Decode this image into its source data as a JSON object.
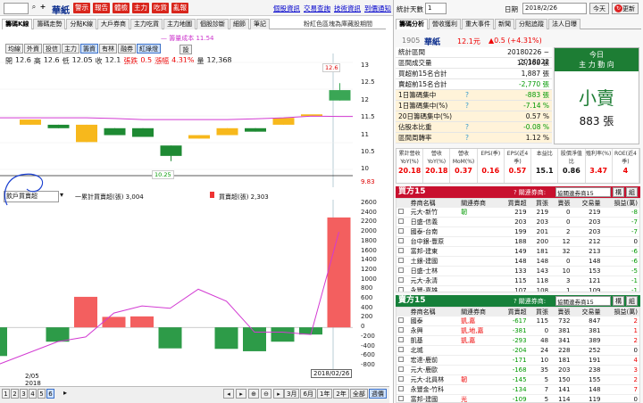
{
  "toolbar": {
    "stock_code": "",
    "stock_name": "華紙",
    "buttons": [
      "警示",
      "報告",
      "體檢",
      "主力",
      "吃貨",
      "亂報"
    ],
    "links": [
      "個股資訊",
      "交易查詢",
      "技術資訊",
      "到價通知"
    ]
  },
  "left": {
    "tabs": [
      "籌碼K線",
      "籌碼走勢",
      "分點K線",
      "大戶券商",
      "主力吃貨",
      "主力地圖",
      "個股診斷",
      "細節",
      "筆記"
    ],
    "note_right": "粉紅色區塊為庫藏股期間",
    "cost_legend": "— 籌量成本 11.54",
    "ma_buttons": [
      "均線",
      "外資",
      "投信",
      "主力",
      "籌資",
      "有林",
      "融券",
      "紅綠燈"
    ],
    "set_label": "設",
    "ohlc": {
      "open_label": "開",
      "open": "12.6",
      "high_label": "高",
      "high": "12.6",
      "low_label": "低",
      "low": "12.05",
      "close_label": "收",
      "close": "12.1",
      "change_label": "張跌",
      "change": "0.5",
      "pct_label": "漲幅",
      "pct": "4.31%",
      "vol_label": "量",
      "vol": "12,368"
    },
    "price_axis": [
      "13",
      "12.5",
      "12",
      "11.5",
      "11",
      "10.5",
      "10"
    ],
    "price_min_label": "9.83",
    "high_tag": "12.6",
    "low_tag": "10.25",
    "lower_select": "飲戶買賣超",
    "legend1": "一累計買賣超(張) 3,004",
    "legend2": "買賣超(張) 2,303",
    "vol_axis": [
      "2600",
      "2400",
      "2200",
      "2000",
      "1800",
      "1600",
      "1400",
      "1200",
      "1000",
      "800",
      "600",
      "400",
      "200",
      "0",
      "-200",
      "-400",
      "-600",
      "-800"
    ],
    "date_left": "2/05",
    "year_left": "2018",
    "date_tag": "2018/02/26",
    "pages": [
      "1",
      "2",
      "3",
      "4",
      "5",
      "6"
    ],
    "period_buttons": [
      "3月",
      "6月",
      "1年",
      "2年",
      "全部",
      "週價"
    ]
  },
  "right": {
    "stat_label": "統計天數",
    "stat_val": "1",
    "date_label": "日期",
    "date_val": "2018/2/26",
    "today_btn": "今天",
    "refresh_btn": "更新",
    "tabs": [
      "籌碼分析",
      "營收獲利",
      "重大事件",
      "新聞",
      "分點追蹤",
      "法人日曝"
    ],
    "stock_code": "1905",
    "stock_name": "華紙",
    "price": "12.1元",
    "change": "▲0.5 (+4.31%)",
    "summary": [
      {
        "label": "統計區間",
        "val": "20180226 ~ 2018022",
        "q": ""
      },
      {
        "label": "區間成交量",
        "val": "12,368 張",
        "q": ""
      },
      {
        "label": "買超前15名合計",
        "val": "1,887 張",
        "q": ""
      },
      {
        "label": "賣超前15名合計",
        "val": "-2,770 張",
        "q": ""
      },
      {
        "label": "1日籌碼集中",
        "val": "-883 張",
        "q": "?"
      },
      {
        "label": "1日籌碼集中(%)",
        "val": "-7.14 %",
        "q": "?"
      },
      {
        "label": "20日籌碼集中(%)",
        "val": "0.57 %",
        "q": ""
      },
      {
        "label": "佔股本比重",
        "val": "-0.08 %",
        "q": "?"
      },
      {
        "label": "區間周轉率",
        "val": "1.12 %",
        "q": "?"
      }
    ],
    "today_title": "今日",
    "today_sub": "主 力 動 向",
    "today_big": "小賣",
    "today_vol": "883 張",
    "stats": [
      {
        "h": "累計營收YoY(%)",
        "v": "20.18",
        "c": "red"
      },
      {
        "h": "營收YoY(%)",
        "v": "20.18",
        "c": "red"
      },
      {
        "h": "營收MoM(%)",
        "v": "0.37",
        "c": "red"
      },
      {
        "h": "EPS(季)",
        "v": "0.16",
        "c": "red"
      },
      {
        "h": "EPS(近4季)",
        "v": "0.57",
        "c": "red"
      },
      {
        "h": "本益比",
        "v": "15.1",
        "c": "black"
      },
      {
        "h": "股價淨值比",
        "v": "0.86",
        "c": "black"
      },
      {
        "h": "殖利率(%)",
        "v": "3.47",
        "c": "red"
      },
      {
        "h": "ROE(近4季)",
        "v": "4",
        "c": "red"
      }
    ],
    "buy_title": "買方15",
    "sell_title": "賣方15",
    "link_label": "關連券商:",
    "link_select": "協關連券商15",
    "link_btns": [
      "構",
      "組"
    ],
    "cols": [
      "券商名稱",
      "關連券商",
      "買賣超",
      "買張",
      "賣張",
      "交易量",
      "損益(萬)"
    ],
    "buy_rows": [
      [
        "元大-新竹",
        "韌",
        "219",
        "219",
        "0",
        "219",
        "-8"
      ],
      [
        "日盛-信義",
        "",
        "203",
        "203",
        "0",
        "203",
        "-7"
      ],
      [
        "國泰-台南",
        "",
        "199",
        "201",
        "2",
        "203",
        "-7"
      ],
      [
        "台中銀-豐原",
        "",
        "188",
        "200",
        "12",
        "212",
        "0"
      ],
      [
        "富邦-建東",
        "",
        "149",
        "181",
        "32",
        "213",
        "-6"
      ],
      [
        "土銀-建國",
        "",
        "148",
        "148",
        "0",
        "148",
        "-6"
      ],
      [
        "日盛-士林",
        "",
        "133",
        "143",
        "10",
        "153",
        "-5"
      ],
      [
        "元大-永清",
        "",
        "115",
        "118",
        "3",
        "121",
        "-1"
      ],
      [
        "永豐-嘉雄",
        "",
        "107",
        "108",
        "1",
        "109",
        "-1"
      ]
    ],
    "sell_rows": [
      [
        "國泰",
        "凱,嘉",
        "-617",
        "115",
        "732",
        "847",
        "2"
      ],
      [
        "永興",
        "凱,地,嘉",
        "-381",
        "0",
        "381",
        "381",
        "1"
      ],
      [
        "凱基",
        "凱,嘉",
        "-293",
        "48",
        "341",
        "389",
        "2"
      ],
      [
        "北城",
        "",
        "-204",
        "24",
        "228",
        "252",
        "0"
      ],
      [
        "宏達-鹿前",
        "",
        "-171",
        "10",
        "181",
        "191",
        "4"
      ],
      [
        "元大-鹿歐",
        "",
        "-168",
        "35",
        "203",
        "238",
        "3"
      ],
      [
        "元大-北員林",
        "韌",
        "-145",
        "5",
        "150",
        "155",
        "2"
      ],
      [
        "永豐金-竹科",
        "",
        "-134",
        "7",
        "141",
        "148",
        "7"
      ],
      [
        "富邦-建國",
        "光",
        "-109",
        "5",
        "114",
        "119",
        "0"
      ]
    ]
  },
  "chart_data": {
    "type": "candlestick",
    "candles": [
      {
        "o": 11.45,
        "c": 11.3,
        "h": 11.45,
        "l": 11.3
      },
      {
        "o": 11.3,
        "c": 11.2,
        "h": 11.3,
        "l": 11.2
      },
      {
        "o": 10.8,
        "c": 11.3,
        "h": 11.3,
        "l": 10.8
      },
      {
        "o": 11.2,
        "c": 11.0,
        "h": 11.2,
        "l": 11.0
      },
      {
        "o": 11.2,
        "c": 10.95,
        "h": 11.2,
        "l": 10.95
      },
      {
        "o": 10.7,
        "c": 10.4,
        "h": 10.7,
        "l": 10.25
      },
      {
        "o": 10.9,
        "c": 11.0,
        "h": 11.0,
        "l": 10.9
      },
      {
        "o": 11.0,
        "c": 11.2,
        "h": 11.2,
        "l": 11.0
      },
      {
        "o": 11.2,
        "c": 11.1,
        "h": 11.2,
        "l": 11.1
      },
      {
        "o": 11.3,
        "c": 11.5,
        "h": 11.5,
        "l": 11.3
      },
      {
        "o": 11.6,
        "c": 11.6,
        "h": 11.6,
        "l": 11.6
      },
      {
        "o": 12.3,
        "c": 12.0,
        "h": 12.5,
        "l": 12.0
      }
    ],
    "candle_colors": [
      "up",
      "down",
      "up",
      "down",
      "down",
      "down",
      "up",
      "up",
      "down",
      "up",
      "up",
      "down"
    ],
    "cost_line": [
      11.5,
      11.5,
      11.5,
      11.48,
      11.45,
      11.45,
      11.45,
      11.45,
      11.47,
      11.5,
      11.55,
      11.54
    ],
    "bars": [
      0,
      0,
      0,
      0,
      0,
      0,
      0,
      0,
      0,
      0,
      0,
      2303
    ],
    "net": [
      -600,
      -300,
      640,
      220,
      230,
      -440,
      0,
      -450,
      -500,
      -300,
      -150,
      2303
    ],
    "cumulative": [
      -800,
      -300,
      -200,
      300,
      450,
      400,
      800,
      550,
      -100,
      -100,
      -150,
      2000
    ]
  }
}
